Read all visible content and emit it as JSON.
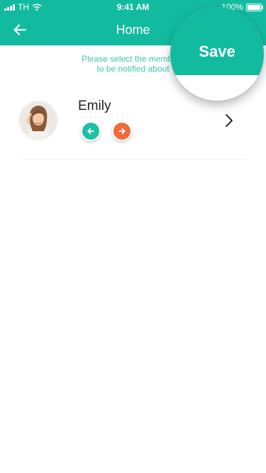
{
  "status_bar": {
    "carrier": "TH",
    "time": "9:41 AM",
    "battery_percent": "100%"
  },
  "nav": {
    "title": "Home",
    "back_icon": "arrow-left-icon"
  },
  "instruction": {
    "line1": "Please select the members",
    "line2": "to be notified about"
  },
  "members": [
    {
      "name": "Emily",
      "left_action_icon": "arrow-left-icon",
      "right_action_icon": "arrow-right-icon",
      "chevron_icon": "chevron-right-icon"
    }
  ],
  "save": {
    "label": "Save"
  },
  "colors": {
    "primary": "#12bba0",
    "instruction_text": "#3dc7b2",
    "action_left": "#1ebfa6",
    "action_right": "#f2693a"
  }
}
